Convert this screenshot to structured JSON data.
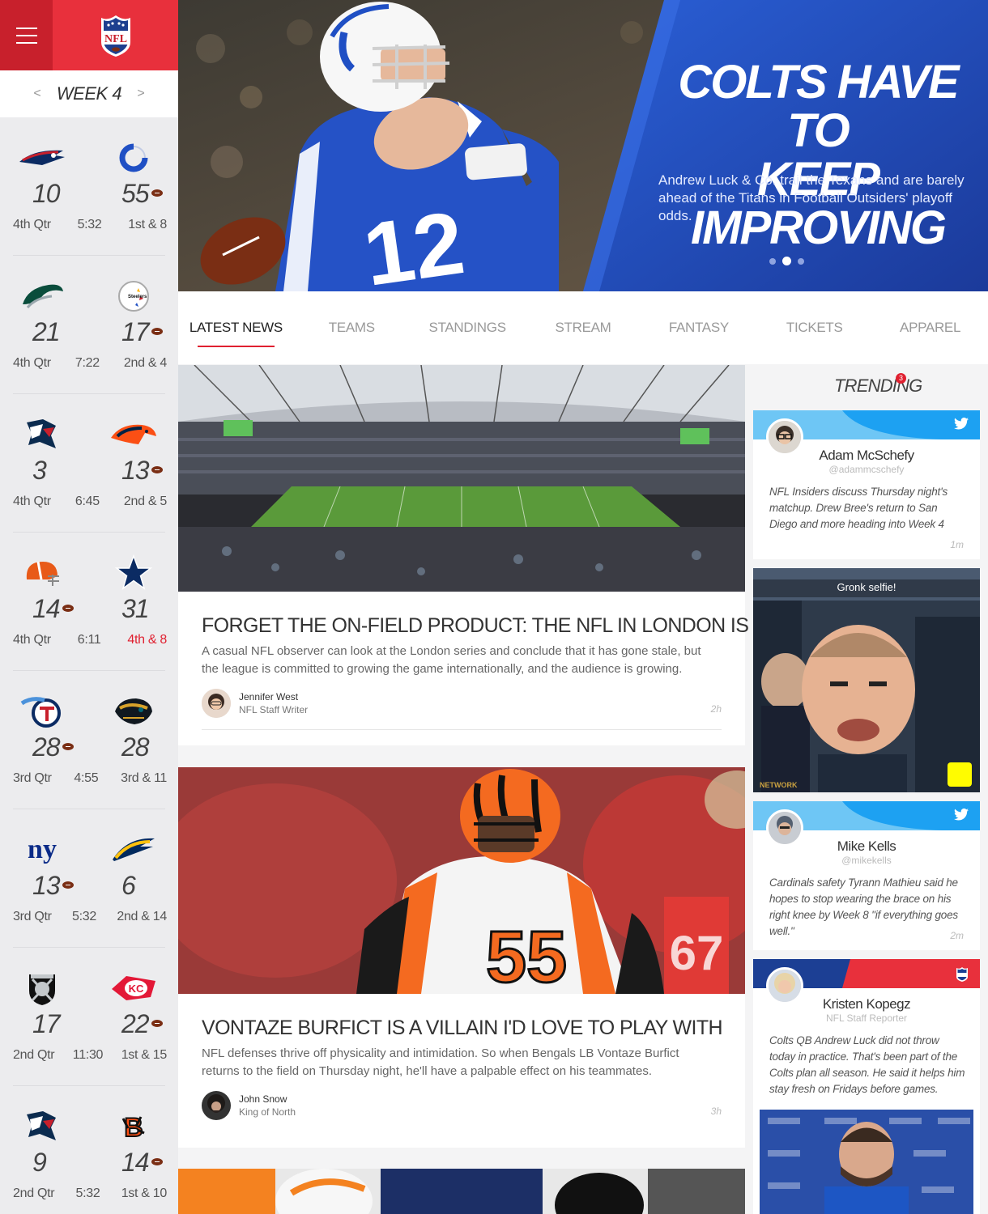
{
  "sidebar": {
    "week_label": "WEEK 4",
    "prev": "<",
    "next": ">",
    "games": [
      {
        "away_logo": "patriots-logo-icon",
        "home_logo": "colts-logo-icon",
        "away_score": "10",
        "home_score": "55",
        "possession": "home",
        "quarter": "4th Qtr",
        "clock": "5:32",
        "down": "1st & 8",
        "down_alert": false
      },
      {
        "away_logo": "eagles-logo-icon",
        "home_logo": "steelers-logo-icon",
        "away_score": "21",
        "home_score": "17",
        "possession": "home",
        "quarter": "4th Qtr",
        "clock": "7:22",
        "down": "2nd & 4",
        "down_alert": false
      },
      {
        "away_logo": "texans-logo-icon",
        "home_logo": "broncos-logo-icon",
        "away_score": "3",
        "home_score": "13",
        "possession": "home",
        "quarter": "4th Qtr",
        "clock": "6:45",
        "down": "2nd & 5",
        "down_alert": false
      },
      {
        "away_logo": "browns-logo-icon",
        "home_logo": "cowboys-logo-icon",
        "away_score": "14",
        "home_score": "31",
        "possession": "away",
        "quarter": "4th Qtr",
        "clock": "6:11",
        "down": "4th & 8",
        "down_alert": true
      },
      {
        "away_logo": "titans-logo-icon",
        "home_logo": "jaguars-logo-icon",
        "away_score": "28",
        "home_score": "28",
        "possession": "away",
        "quarter": "3rd Qtr",
        "clock": "4:55",
        "down": "3rd & 11",
        "down_alert": false
      },
      {
        "away_logo": "giants-logo-icon",
        "home_logo": "chargers-logo-icon",
        "away_score": "13",
        "home_score": "6",
        "possession": "away",
        "quarter": "3rd Qtr",
        "clock": "5:32",
        "down": "2nd & 14",
        "down_alert": false
      },
      {
        "away_logo": "raiders-logo-icon",
        "home_logo": "chiefs-logo-icon",
        "away_score": "17",
        "home_score": "22",
        "possession": "home",
        "quarter": "2nd Qtr",
        "clock": "11:30",
        "down": "1st & 15",
        "down_alert": false
      },
      {
        "away_logo": "texans-logo-icon",
        "home_logo": "bengals-logo-icon",
        "away_score": "9",
        "home_score": "14",
        "possession": "home",
        "quarter": "2nd Qtr",
        "clock": "5:32",
        "down": "1st & 10",
        "down_alert": false
      }
    ]
  },
  "hero": {
    "title_line1": "COLTS HAVE TO",
    "title_line2": "KEEP IMPROVING",
    "subtitle": "Andrew Luck & Co. trail the Texans and are barely ahead of the Titans in Football Outsiders' playoff odds.",
    "jersey_number": "12",
    "slides": 3,
    "active_slide": 1
  },
  "nav": {
    "tabs": [
      "LATEST NEWS",
      "TEAMS",
      "STANDINGS",
      "STREAM",
      "FANTASY",
      "TICKETS",
      "APPAREL"
    ],
    "active": 0
  },
  "articles": [
    {
      "title": "FORGET THE ON-FIELD PRODUCT: THE NFL IN LONDON IS WORKING",
      "excerpt": "A casual NFL observer can look at the London series and conclude that it has gone stale, but the league is committed to growing the game internationally, and the audience is growing.",
      "author": "Jennifer West",
      "role": "NFL Staff Writer",
      "time": "2h"
    },
    {
      "title": "VONTAZE BURFICT IS A VILLAIN I'D LOVE TO PLAY WITH",
      "excerpt": "NFL defenses thrive off physicality and intimidation. So when Bengals LB Vontaze Burfict returns to the field on Thursday night, he'll have a palpable effect on his teammates.",
      "author": "John Snow",
      "role": "King of North",
      "time": "3h",
      "jersey_number": "55"
    }
  ],
  "trending": {
    "title": "TRENDING",
    "badge": "3",
    "cards": [
      {
        "name": "Adam McSchefy",
        "handle": "@adammcschefy",
        "body": "NFL Insiders discuss Thursday night's matchup. Drew Bree's return to San Diego and more heading into Week 4",
        "time": "1m"
      },
      {
        "caption": "Gronk selfie!"
      },
      {
        "name": "Mike Kells",
        "handle": "@mikekells",
        "body": "Cardinals safety Tyrann Mathieu said he hopes to stop wearing the brace on his right knee by Week 8 \"if everything goes well.\"",
        "time": "2m"
      },
      {
        "name": "Kristen Kopegz",
        "handle": "NFL Staff Reporter",
        "body": "Colts QB Andrew Luck did not throw today in practice. That's been part of the Colts plan all season. He said it helps him stay fresh on Fridays before games."
      }
    ]
  },
  "colors": {
    "nfl_red": "#e8303c",
    "nfl_dark_red": "#c8202c",
    "colts_blue": "#1f4fc4",
    "twitter_blue": "#1da1f2",
    "alert_red": "#e02030"
  }
}
